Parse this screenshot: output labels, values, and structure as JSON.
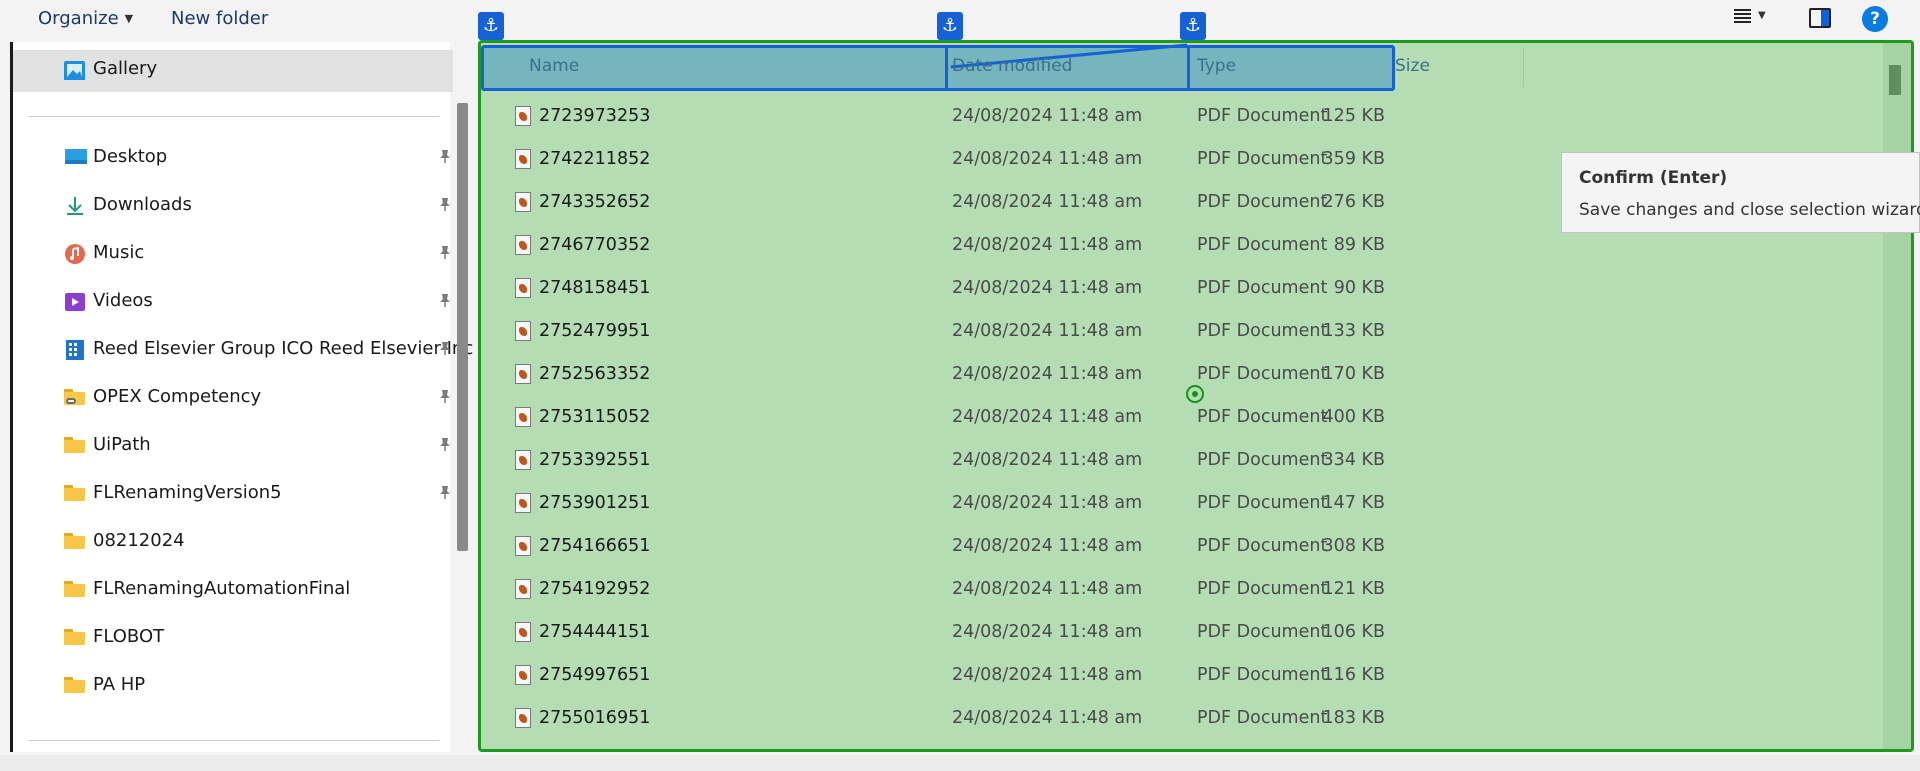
{
  "toolbar": {
    "organize_label": "Organize",
    "new_folder_label": "New folder"
  },
  "sidebar": {
    "gallery_label": "Gallery",
    "items": [
      {
        "label": "Desktop",
        "icon": "desktop-icon",
        "pinned": true
      },
      {
        "label": "Downloads",
        "icon": "download-icon",
        "pinned": true
      },
      {
        "label": "Music",
        "icon": "music-icon",
        "pinned": true
      },
      {
        "label": "Videos",
        "icon": "videos-icon",
        "pinned": true
      },
      {
        "label": "Reed Elsevier Group ICO Reed Elsevier Inc",
        "icon": "building-icon",
        "pinned": true
      },
      {
        "label": "OPEX Competency",
        "icon": "network-folder-icon",
        "pinned": true
      },
      {
        "label": "UiPath",
        "icon": "folder-icon",
        "pinned": true
      },
      {
        "label": "FLRenamingVersion5",
        "icon": "folder-icon",
        "pinned": true
      },
      {
        "label": "08212024",
        "icon": "folder-icon",
        "pinned": false
      },
      {
        "label": "FLRenamingAutomationFinal",
        "icon": "folder-icon",
        "pinned": false
      },
      {
        "label": "FLOBOT",
        "icon": "folder-icon",
        "pinned": false
      },
      {
        "label": "PA HP",
        "icon": "folder-icon",
        "pinned": false
      }
    ]
  },
  "columns": {
    "name": "Name",
    "date": "Date modified",
    "type": "Type",
    "size": "Size"
  },
  "files": [
    {
      "name": "2723973253",
      "date": "24/08/2024 11:48 am",
      "type": "PDF Document",
      "size": "125 KB"
    },
    {
      "name": "2742211852",
      "date": "24/08/2024 11:48 am",
      "type": "PDF Document",
      "size": "359 KB"
    },
    {
      "name": "2743352652",
      "date": "24/08/2024 11:48 am",
      "type": "PDF Document",
      "size": "276 KB"
    },
    {
      "name": "2746770352",
      "date": "24/08/2024 11:48 am",
      "type": "PDF Document",
      "size": "89 KB"
    },
    {
      "name": "2748158451",
      "date": "24/08/2024 11:48 am",
      "type": "PDF Document",
      "size": "90 KB"
    },
    {
      "name": "2752479951",
      "date": "24/08/2024 11:48 am",
      "type": "PDF Document",
      "size": "133 KB"
    },
    {
      "name": "2752563352",
      "date": "24/08/2024 11:48 am",
      "type": "PDF Document",
      "size": "170 KB"
    },
    {
      "name": "2753115052",
      "date": "24/08/2024 11:48 am",
      "type": "PDF Document",
      "size": "400 KB"
    },
    {
      "name": "2753392551",
      "date": "24/08/2024 11:48 am",
      "type": "PDF Document",
      "size": "334 KB"
    },
    {
      "name": "2753901251",
      "date": "24/08/2024 11:48 am",
      "type": "PDF Document",
      "size": "147 KB"
    },
    {
      "name": "2754166651",
      "date": "24/08/2024 11:48 am",
      "type": "PDF Document",
      "size": "308 KB"
    },
    {
      "name": "2754192952",
      "date": "24/08/2024 11:48 am",
      "type": "PDF Document",
      "size": "121 KB"
    },
    {
      "name": "2754444151",
      "date": "24/08/2024 11:48 am",
      "type": "PDF Document",
      "size": "106 KB"
    },
    {
      "name": "2754997651",
      "date": "24/08/2024 11:48 am",
      "type": "PDF Document",
      "size": "116 KB"
    },
    {
      "name": "2755016951",
      "date": "24/08/2024 11:48 am",
      "type": "PDF Document",
      "size": "183 KB"
    }
  ],
  "tooltip": {
    "title": "Confirm (Enter)",
    "body": "Save changes and close selection wizard."
  },
  "colors": {
    "selection_fill": "#b5ddb4",
    "selection_border": "#1e9b1e",
    "anchor_blue": "#1761d6",
    "header_fill": "#75b5bd"
  }
}
